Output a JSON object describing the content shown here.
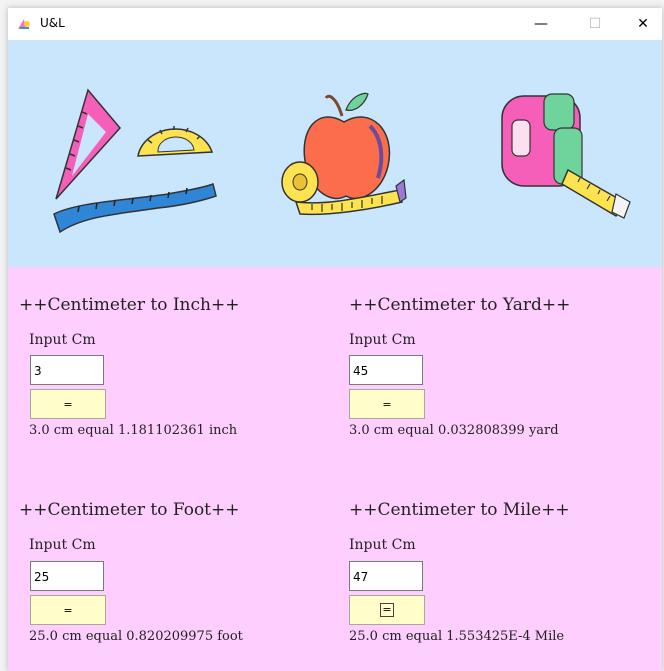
{
  "window": {
    "title": "U&L",
    "minimize_glyph": "—",
    "maximize_glyph": "☐",
    "close_glyph": "✕"
  },
  "banner": {
    "icons": [
      "triangle-ruler-protractor-icon",
      "apple-measuring-tape-icon",
      "tape-measure-icon"
    ]
  },
  "converters": [
    {
      "heading": "++Centimeter to Inch++",
      "input_label": "Input Cm",
      "input_value": "3",
      "button_label": "=",
      "result": "3.0 cm equal 1.181102361 inch"
    },
    {
      "heading": "++Centimeter to Yard++",
      "input_label": "Input Cm",
      "input_value": "45",
      "button_label": "=",
      "result": "3.0 cm equal 0.032808399 yard"
    },
    {
      "heading": "++Centimeter to Foot++",
      "input_label": "Input Cm",
      "input_value": "25",
      "button_label": "=",
      "result": "25.0 cm equal 0.820209975 foot"
    },
    {
      "heading": "++Centimeter to Mile++",
      "input_label": "Input Cm",
      "input_value": "47",
      "button_label": "=",
      "result": "25.0 cm equal 1.553425E-4 Mile"
    }
  ],
  "colors": {
    "banner_bg": "#cae6fd",
    "content_bg": "#fecffe",
    "button_bg": "#fffdc9"
  }
}
